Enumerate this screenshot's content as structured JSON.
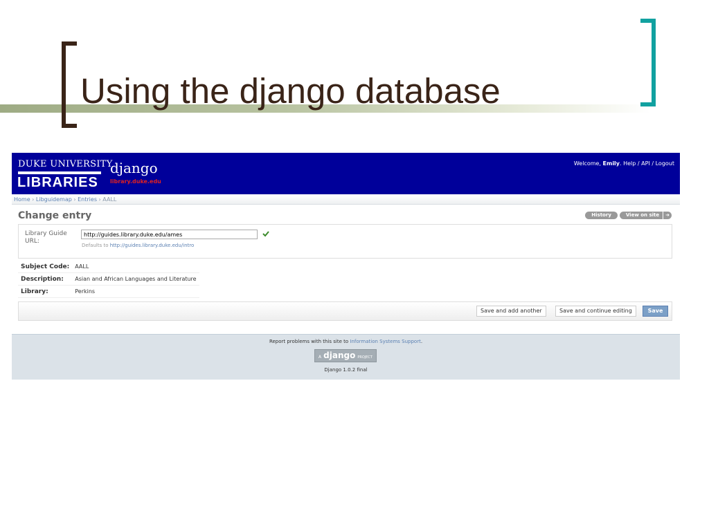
{
  "slide": {
    "title": "Using the django database"
  },
  "header": {
    "logo_line1": "DUKE UNIVERSITY",
    "logo_line2": "LIBRARIES",
    "brand": "django",
    "brand_sub": "library.duke.edu",
    "welcome": "Welcome,",
    "user": "Emily",
    "help": "Help",
    "api": "API",
    "logout": "Logout"
  },
  "breadcrumb": {
    "home": "Home",
    "app": "Libguidemap",
    "model": "Entries",
    "current": "AALL"
  },
  "page": {
    "title": "Change entry",
    "history_button": "History",
    "view_on_site_button": "View on site",
    "view_on_site_arrow": "➜"
  },
  "form": {
    "url_label": "Library Guide URL:",
    "url_value": "http://guides.library.duke.edu/ames",
    "help_prefix": "Defaults to",
    "help_link": "http://guides.library.duke.edu/intro"
  },
  "readonly": [
    {
      "label": "Subject Code:",
      "value": "AALL"
    },
    {
      "label": "Description:",
      "value": "Asian and African Languages and Literature"
    },
    {
      "label": "Library:",
      "value": "Perkins"
    }
  ],
  "submit": {
    "save_add": "Save and add another",
    "save_continue": "Save and continue editing",
    "save": "Save"
  },
  "footer": {
    "report_prefix": "Report problems with this site to",
    "report_link": "Information Systems Support",
    "badge_a": "A",
    "badge_django": "django",
    "badge_project": "PROJECT",
    "version": "Django 1.0.2 final"
  },
  "colors": {
    "header_bg": "#00009a",
    "accent_teal": "#11a1a0",
    "title_brown": "#3a2418",
    "save_button": "#7ca0c7"
  }
}
